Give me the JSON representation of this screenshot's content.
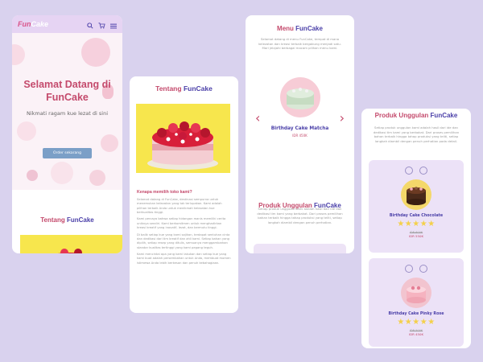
{
  "colors": {
    "background": "#d9d2ee",
    "accent_pink": "#c44a6c",
    "accent_purple": "#4a3fa8",
    "button_blue": "#7b9fc7",
    "star": "#f4d04a",
    "nav_bg": "#e6d4f3",
    "product_card_bg": "#ece2f7"
  },
  "screen1": {
    "logo_accent": "Fun",
    "logo_rest": "Cake",
    "icons": [
      "search-icon",
      "cart-icon",
      "menu-icon"
    ],
    "hero_title": "Selamat Datang di FunCake",
    "hero_subtitle": "Nikmati ragam kue lezat di sini",
    "cta_label": "Order sekarang",
    "about_title_a": "Tentang",
    "about_title_b": "FunCake"
  },
  "screen2": {
    "title_a": "Tentang",
    "title_b": "FunCake",
    "why_heading": "Kenapa memilih toko kami?",
    "paragraphs": [
      "Selamat datang di FunCake, destinasi sempurna untuk menemukan kelezatan yang tak terlupakan. Kami adalah pilihan terbaik Anda untuk menikmati kelezatan kue berkualitas tinggi.",
      "Kami percaya bahwa setiap hidangan manis memiliki cerita uniknya sendiri. Kami berkomitmen untuk menghadirkan kreasi kreatif yang inovatif, lezat, dan bermutu tinggi.",
      "Di balik setiap kue yang kami sajikan, terdapat sentuhan cinta dan dedikasi dari tim kreatif dan ahli kami. Setiap bahan yang dipilih, setiap resep yang ditulis, semuanya menggambarkan standar kualitas tertinggi yang kami pegang teguh.",
      "Kami mencintai apa yang kami lakukan dan setiap kue yang kami buat adalah persembahan untuk Anda, membuat momen istimewa Anda lebih berkesan dan penuh kebahagiaan."
    ]
  },
  "screen3": {
    "title_a": "Menu",
    "title_b": "FunCake",
    "intro": "Selamat datang di menu FunCake, tempat di mana kelezatan dan kreasi terbaik bergabung menjadi satu. Mari jelajahi berbagai macam pilihan menu kami.",
    "product_name": "Birthday Cake Matcha",
    "product_price": "IDR 450K",
    "featured_title_a": "Produk Unggulan",
    "featured_title_b": "FunCake",
    "featured_intro": "Setiap produk unggulan kami adalah hasil dari ide dan dedikasi tim kami yang berbakat. Dari proses pemilihan bahan terbaik hingga tahap produksi yang teliti, setiap langkah diambil dengan penuh perhatian."
  },
  "screen4": {
    "title_a": "Produk Unggulan",
    "title_b": "FunCake",
    "intro": "Setiap produk unggulan kami adalah hasil dari ide dan dedikasi tim kami yang berbakat. Dari proses pemilihan bahan terbaik hingga tahap produksi yang teliti, setiap langkah diambil dengan penuh perhatian pada detail.",
    "products": [
      {
        "name": "Birthday Cake Chocolate",
        "rating": 5,
        "old_price": "IDR 600K",
        "price": "IDR 550K"
      },
      {
        "name": "Birthday Cake Pinky Rose",
        "rating": 5,
        "old_price": "IDR 500K",
        "price": "IDR 450K"
      }
    ]
  }
}
